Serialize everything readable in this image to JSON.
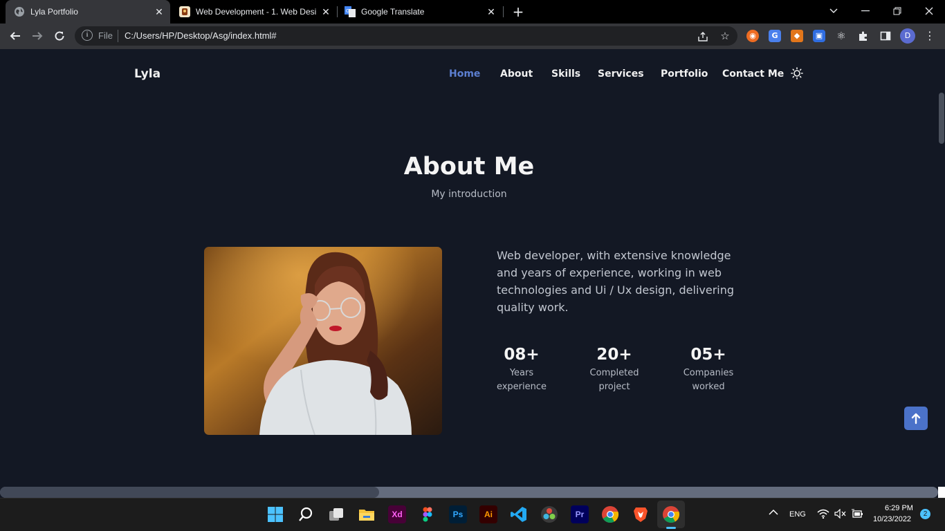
{
  "browser": {
    "tabs": [
      {
        "title": "Lyla Portfolio",
        "active": true,
        "favicon": "globe-icon"
      },
      {
        "title": "Web Development - 1. Web Desi",
        "active": false,
        "favicon": "course-icon"
      },
      {
        "title": "Google Translate",
        "active": false,
        "favicon": "translate-icon"
      }
    ],
    "omnibox": {
      "scheme_label": "File",
      "url": "C:/Users/HP/Desktop/Asg/index.html#"
    },
    "profile_initial": "D"
  },
  "site": {
    "logo": "Lyla",
    "nav": [
      {
        "label": "Home",
        "active": true
      },
      {
        "label": "About",
        "active": false
      },
      {
        "label": "Skills",
        "active": false
      },
      {
        "label": "Services",
        "active": false
      },
      {
        "label": "Portfolio",
        "active": false
      },
      {
        "label": "Contact Me",
        "active": false
      }
    ],
    "theme_toggle_icon": "sun-icon",
    "accent_color": "#5c7fd1"
  },
  "about": {
    "title": "About Me",
    "subtitle": "My introduction",
    "description": "Web developer, with extensive knowledge and years of experience, working in web technologies and Ui / Ux design, delivering quality work.",
    "stats": [
      {
        "number": "08+",
        "label_line1": "Years",
        "label_line2": "experience"
      },
      {
        "number": "20+",
        "label_line1": "Completed",
        "label_line2": "project"
      },
      {
        "number": "05+",
        "label_line1": "Companies",
        "label_line2": "worked"
      }
    ]
  },
  "taskbar": {
    "apps": [
      "windows-start-icon",
      "search-icon",
      "task-view-icon",
      "file-explorer-icon",
      "adobe-xd-icon",
      "figma-icon",
      "photoshop-icon",
      "illustrator-icon",
      "vscode-icon",
      "davinci-resolve-icon",
      "premiere-icon",
      "chrome-icon",
      "brave-icon",
      "chrome-icon"
    ],
    "xd_label": "Xd",
    "ps_label": "Ps",
    "ai_label": "Ai",
    "pr_label": "Pr",
    "language": "ENG",
    "time": "6:29 PM",
    "date": "10/23/2022",
    "notification_count": "2"
  }
}
